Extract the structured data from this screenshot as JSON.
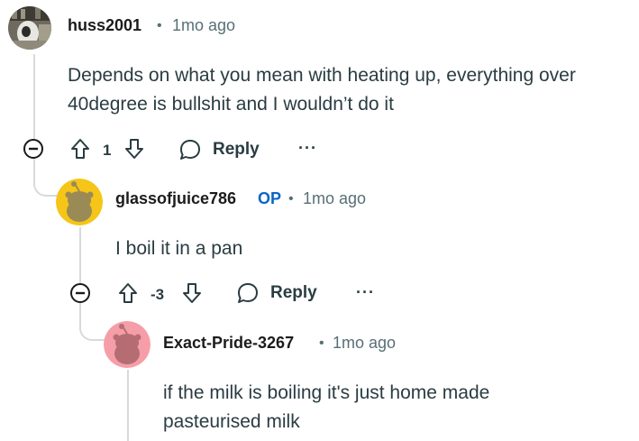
{
  "comments": [
    {
      "username": "huss2001",
      "time": "1mo ago",
      "body_lines": [
        "Depends on what you mean with heating up, everything over",
        "40degree is bullshit and I wouldn’t do it"
      ],
      "votes": "1",
      "reply_label": "Reply",
      "more_label": "···"
    },
    {
      "username": "glassofjuice786",
      "badge": "OP",
      "time": "1mo ago",
      "body_lines": [
        "I boil it in a pan"
      ],
      "votes": "-3",
      "reply_label": "Reply",
      "more_label": "···",
      "avatar_color": "#f5c518"
    },
    {
      "username": "Exact-Pride-3267",
      "time": "1mo ago",
      "body_lines": [
        "if the milk is boiling it's just home made",
        "pasteurised milk"
      ],
      "avatar_color": "#f69ea8"
    }
  ],
  "separator": "•"
}
